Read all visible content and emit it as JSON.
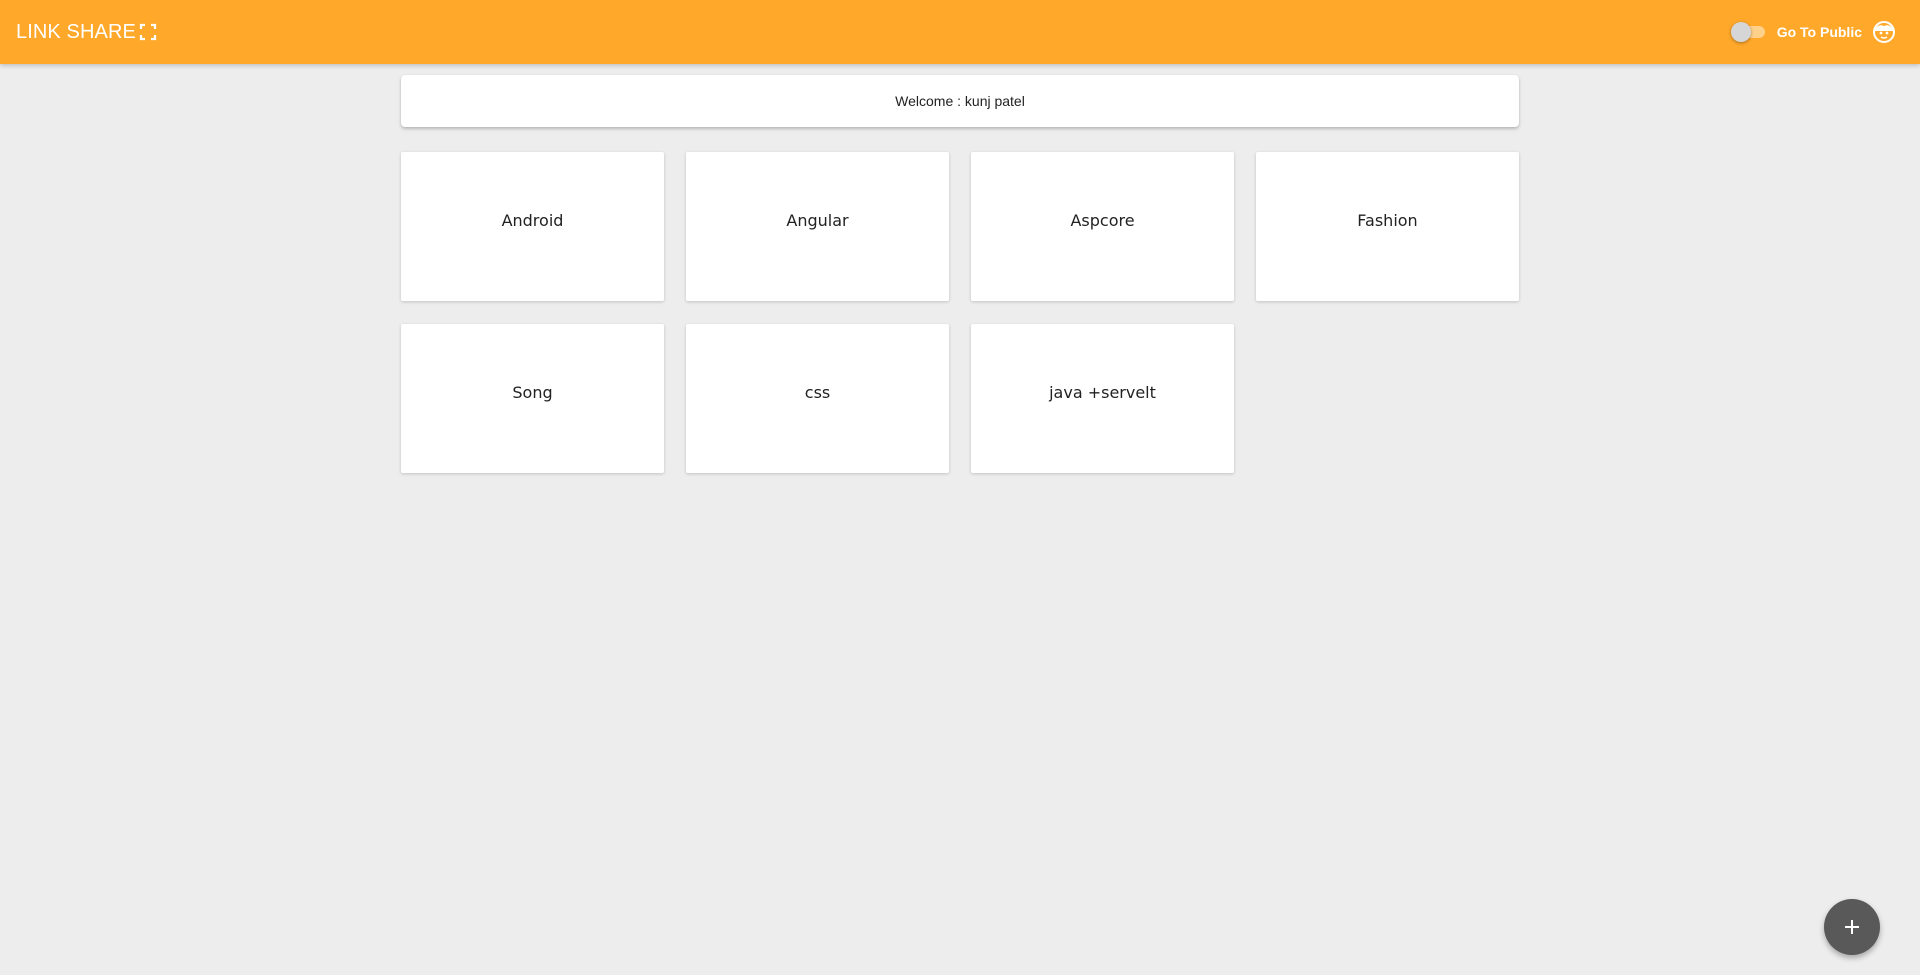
{
  "header": {
    "title": "LINK SHARE",
    "fullscreen_icon": "fullscreen-icon",
    "toggle_label": "Go To Public",
    "toggle_on": false,
    "avatar_icon": "account-face-icon",
    "background_color": "#ffa82a"
  },
  "welcome": {
    "text": "Welcome : kunj patel"
  },
  "categories": [
    {
      "label": "Android"
    },
    {
      "label": "Angular"
    },
    {
      "label": "Aspcore"
    },
    {
      "label": "Fashion"
    },
    {
      "label": "Song"
    },
    {
      "label": "css"
    },
    {
      "label": "java +servelt"
    }
  ],
  "fab": {
    "icon": "plus-icon",
    "color": "#595959"
  }
}
